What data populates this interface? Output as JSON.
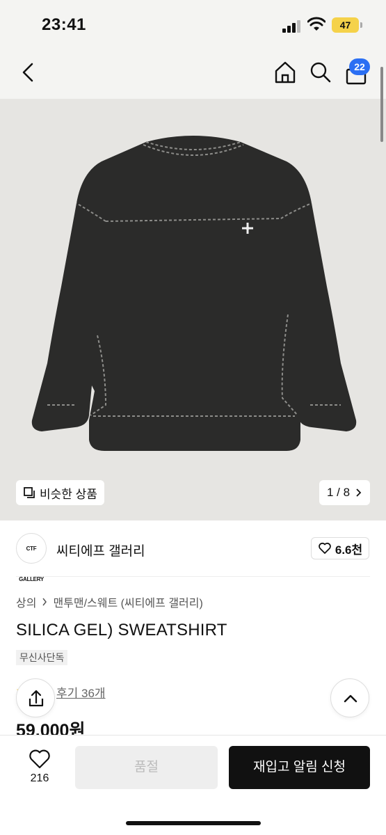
{
  "status_bar": {
    "time": "23:41",
    "battery": "47"
  },
  "nav": {
    "cart_badge": "22"
  },
  "hero": {
    "similar_label": "비슷한 상품",
    "pager": "1 / 8"
  },
  "brand": {
    "logo_text": "CTF GALLERY",
    "name": "씨티에프 갤러리",
    "likes": "6.6천"
  },
  "breadcrumb": {
    "category": "상의",
    "subcategory": "맨투맨/스웨트 (씨티에프 갤러리)"
  },
  "product": {
    "title": "SILICA GEL) SWEATSHIRT",
    "badge": "무신사단독",
    "reviews": "후기 36개",
    "price": "59,000원"
  },
  "bottom_bar": {
    "wish_count": "216",
    "soldout_label": "품절",
    "restock_label": "재입고 알림 신청"
  },
  "colors": {
    "accent": "#2b6ff3",
    "battery": "#f5d24a",
    "primary_button": "#111111",
    "rating_star": "#f5b800"
  }
}
